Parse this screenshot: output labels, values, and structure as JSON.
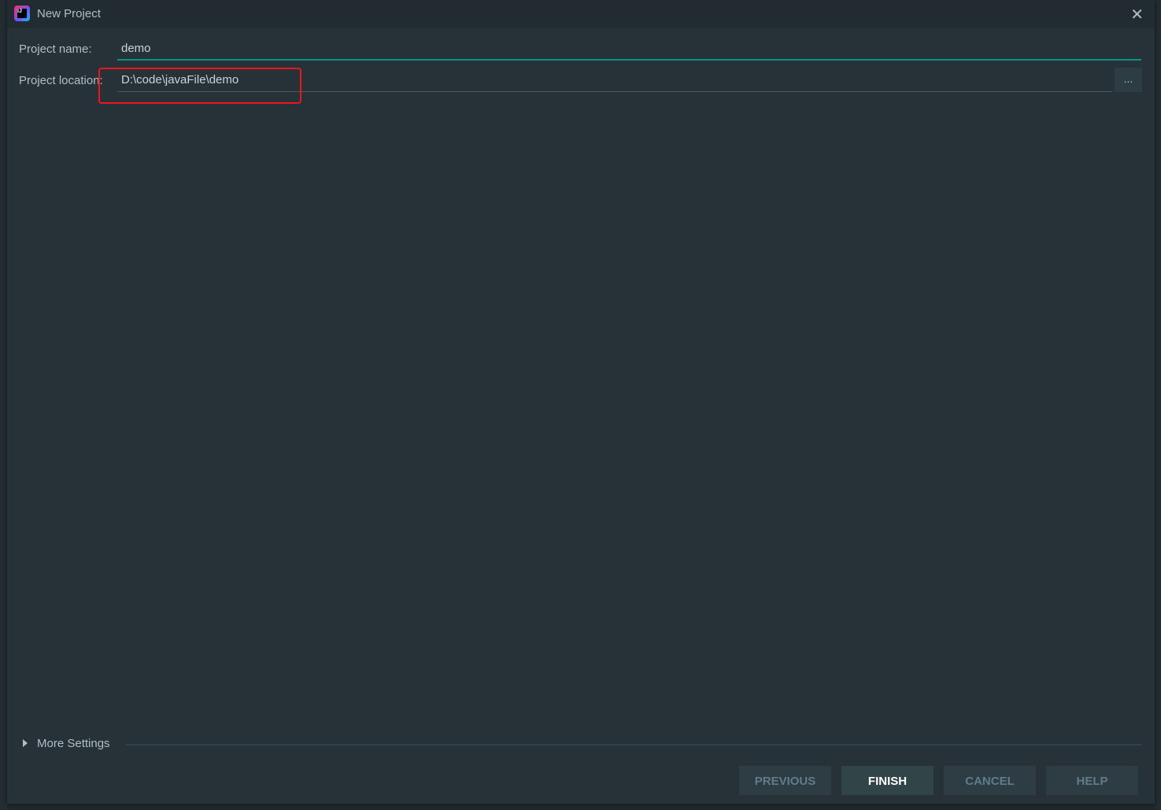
{
  "dialog": {
    "title": "New Project",
    "icon": "intellij-logo",
    "close_icon": "close-icon"
  },
  "form": {
    "name_label": "Project name:",
    "name_value": "demo",
    "location_label": "Project location:",
    "location_value": "D:\\code\\javaFile\\demo",
    "browse_label": "..."
  },
  "highlight_color": "#f0141e",
  "accent": "#009688",
  "more_settings": "More Settings",
  "buttons": {
    "previous": "PREVIOUS",
    "finish": "FINISH",
    "cancel": "CANCEL",
    "help": "HELP"
  }
}
